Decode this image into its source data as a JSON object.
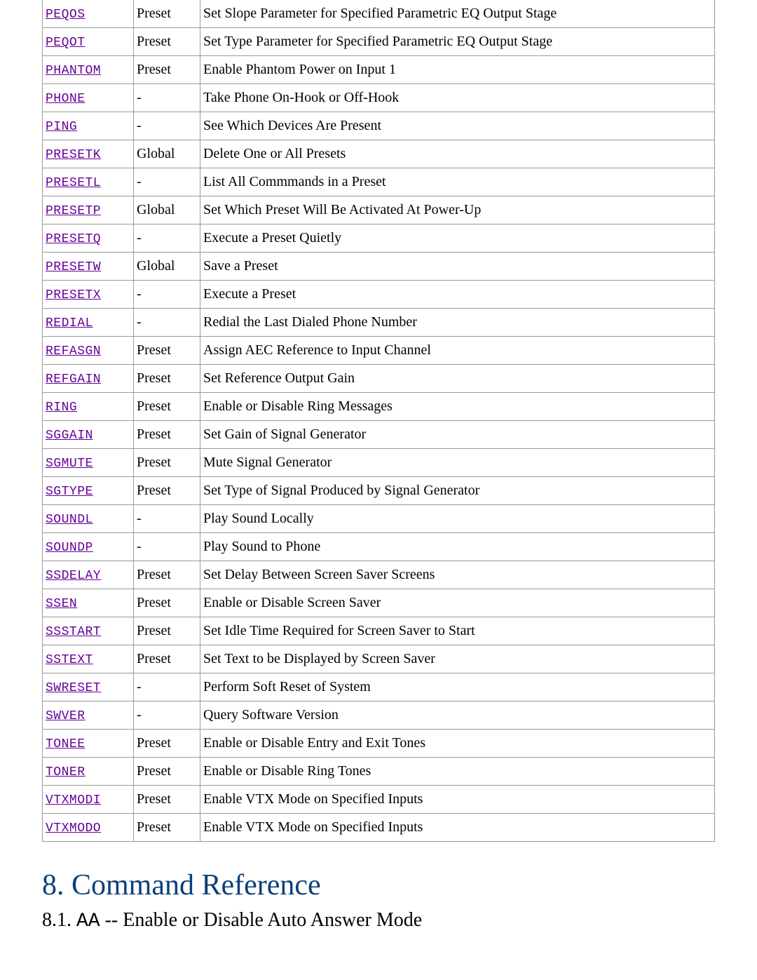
{
  "rows": [
    {
      "cmd": "PEQOS",
      "type": "Preset",
      "desc": "Set Slope Parameter for Specified Parametric EQ Output Stage"
    },
    {
      "cmd": "PEQOT",
      "type": "Preset",
      "desc": "Set Type Parameter for Specified Parametric EQ Output Stage"
    },
    {
      "cmd": "PHANTOM",
      "type": "Preset",
      "desc": "Enable Phantom Power on Input 1"
    },
    {
      "cmd": "PHONE",
      "type": "-",
      "desc": "Take Phone On-Hook or Off-Hook"
    },
    {
      "cmd": "PING",
      "type": "-",
      "desc": "See Which Devices Are Present"
    },
    {
      "cmd": "PRESETK",
      "type": "Global",
      "desc": "Delete One or All Presets"
    },
    {
      "cmd": "PRESETL",
      "type": "-",
      "desc": "List All Commmands in a Preset"
    },
    {
      "cmd": "PRESETP",
      "type": "Global",
      "desc": "Set Which Preset Will Be Activated At Power-Up"
    },
    {
      "cmd": "PRESETQ",
      "type": "-",
      "desc": "Execute a Preset Quietly"
    },
    {
      "cmd": "PRESETW",
      "type": "Global",
      "desc": "Save a Preset"
    },
    {
      "cmd": "PRESETX",
      "type": "-",
      "desc": "Execute a Preset"
    },
    {
      "cmd": "REDIAL",
      "type": "-",
      "desc": "Redial the Last Dialed Phone Number"
    },
    {
      "cmd": "REFASGN",
      "type": "Preset",
      "desc": "Assign AEC Reference to Input Channel"
    },
    {
      "cmd": "REFGAIN",
      "type": "Preset",
      "desc": "Set Reference Output Gain"
    },
    {
      "cmd": "RING",
      "type": "Preset",
      "desc": "Enable or Disable Ring Messages"
    },
    {
      "cmd": "SGGAIN",
      "type": "Preset",
      "desc": "Set Gain of Signal Generator"
    },
    {
      "cmd": "SGMUTE",
      "type": "Preset",
      "desc": "Mute Signal Generator"
    },
    {
      "cmd": "SGTYPE",
      "type": "Preset",
      "desc": "Set Type of Signal Produced by Signal Generator"
    },
    {
      "cmd": "SOUNDL",
      "type": "-",
      "desc": "Play Sound Locally"
    },
    {
      "cmd": "SOUNDP",
      "type": "-",
      "desc": "Play Sound to Phone"
    },
    {
      "cmd": "SSDELAY",
      "type": "Preset",
      "desc": "Set Delay Between Screen Saver Screens"
    },
    {
      "cmd": "SSEN",
      "type": "Preset",
      "desc": "Enable or Disable Screen Saver"
    },
    {
      "cmd": "SSSTART",
      "type": "Preset",
      "desc": "Set Idle Time Required for Screen Saver to Start"
    },
    {
      "cmd": "SSTEXT",
      "type": "Preset",
      "desc": "Set Text to be Displayed by Screen Saver"
    },
    {
      "cmd": "SWRESET",
      "type": "-",
      "desc": "Perform Soft Reset of System"
    },
    {
      "cmd": "SWVER",
      "type": "-",
      "desc": "Query Software Version"
    },
    {
      "cmd": "TONEE",
      "type": "Preset",
      "desc": "Enable or Disable Entry and Exit Tones"
    },
    {
      "cmd": "TONER",
      "type": "Preset",
      "desc": "Enable or Disable Ring Tones"
    },
    {
      "cmd": "VTXMODI",
      "type": "Preset",
      "desc": "Enable VTX Mode on Specified Inputs"
    },
    {
      "cmd": "VTXMODO",
      "type": "Preset",
      "desc": "Enable VTX Mode on Specified Inputs"
    }
  ],
  "section": {
    "title": "8. Command Reference",
    "sub_prefix": "8.1. ",
    "sub_cmd": "AA",
    "sub_suffix": " -- Enable or Disable Auto Answer Mode"
  }
}
